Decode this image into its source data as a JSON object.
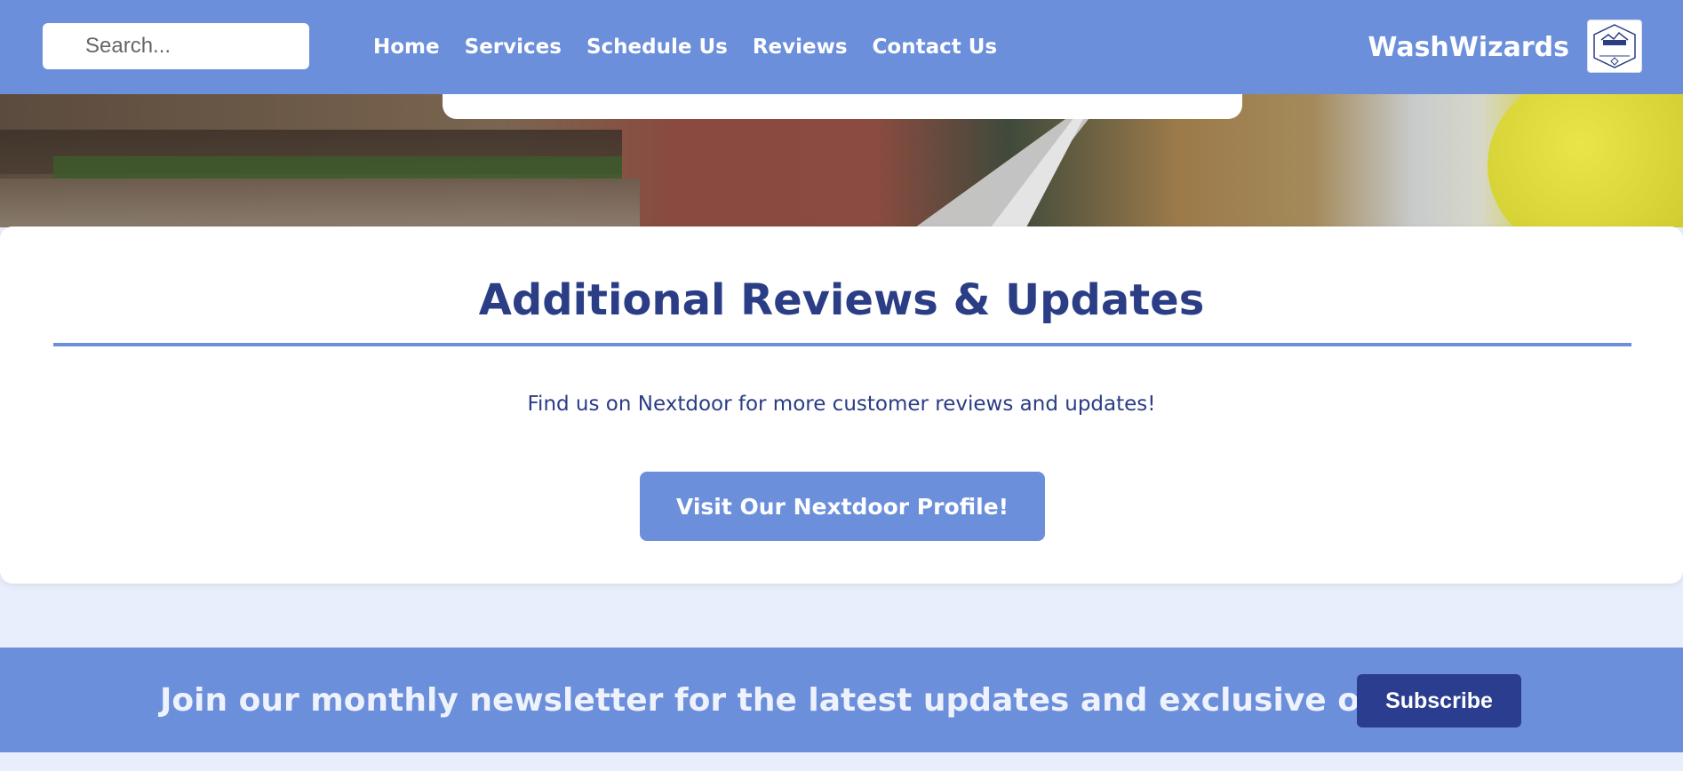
{
  "header": {
    "search_placeholder": "Search...",
    "nav": [
      "Home",
      "Services",
      "Schedule Us",
      "Reviews",
      "Contact Us"
    ],
    "brand": "WashWizards",
    "logo_text": "WASH WIZARDS"
  },
  "reviews": {
    "title": "Additional Reviews & Updates",
    "text": "Find us on Nextdoor for more customer reviews and updates!",
    "button": "Visit Our Nextdoor Profile!"
  },
  "newsletter": {
    "message": "Join our monthly newsletter for the latest updates and exclusive offers!",
    "button": "Subscribe"
  },
  "colors": {
    "primary": "#6b8fdb",
    "dark_blue": "#2a3d85",
    "page_bg": "#e8eefb"
  }
}
